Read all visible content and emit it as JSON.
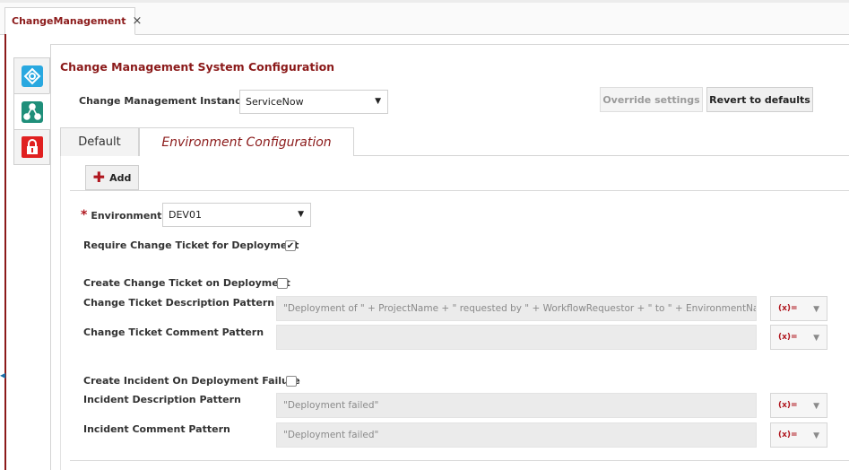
{
  "tab": {
    "title": "ChangeManagement",
    "close_glyph": "×"
  },
  "sidebar": {
    "items": [
      {
        "icon": "integration-icon",
        "color": "#29a8e0",
        "active": false
      },
      {
        "icon": "workflow-icon",
        "color": "#1f8f7a",
        "active": true
      },
      {
        "icon": "lock-icon",
        "color": "#e02020",
        "active": false
      }
    ]
  },
  "page_title": "Change Management System Configuration",
  "cm_instance": {
    "label": "Change Management Instance",
    "value": "ServiceNow"
  },
  "buttons": {
    "override": "Override settings",
    "revert": "Revert to defaults",
    "add": "Add"
  },
  "tabs": {
    "default": "Default",
    "environment": "Environment Configuration"
  },
  "environment": {
    "required_mark": "*",
    "label": "Environment",
    "value": "DEV01"
  },
  "require_ticket": {
    "label": "Require Change Ticket for Deployment",
    "checked": true
  },
  "create_ticket": {
    "label": "Create Change Ticket on Deployment",
    "checked": false
  },
  "ticket_description": {
    "label": "Change Ticket Description Pattern",
    "value": "\"Deployment of \" + ProjectName + \" requested by \" + WorkflowRequestor + \" to \" + EnvironmentName"
  },
  "ticket_comment": {
    "label": "Change Ticket Comment Pattern",
    "value": ""
  },
  "create_incident": {
    "label": "Create Incident On Deployment Failure",
    "checked": false
  },
  "incident_description": {
    "label": "Incident Description Pattern",
    "value": "\"Deployment failed\""
  },
  "incident_comment": {
    "label": "Incident Comment Pattern",
    "value": "\"Deployment failed\""
  },
  "variable_button": {
    "label": "(x)="
  },
  "glyphs": {
    "dropdown": "▼",
    "check": "✔",
    "plus": "✚",
    "handle": "◀"
  },
  "colors": {
    "accent": "#8b1a1a",
    "required": "#b0171f"
  }
}
